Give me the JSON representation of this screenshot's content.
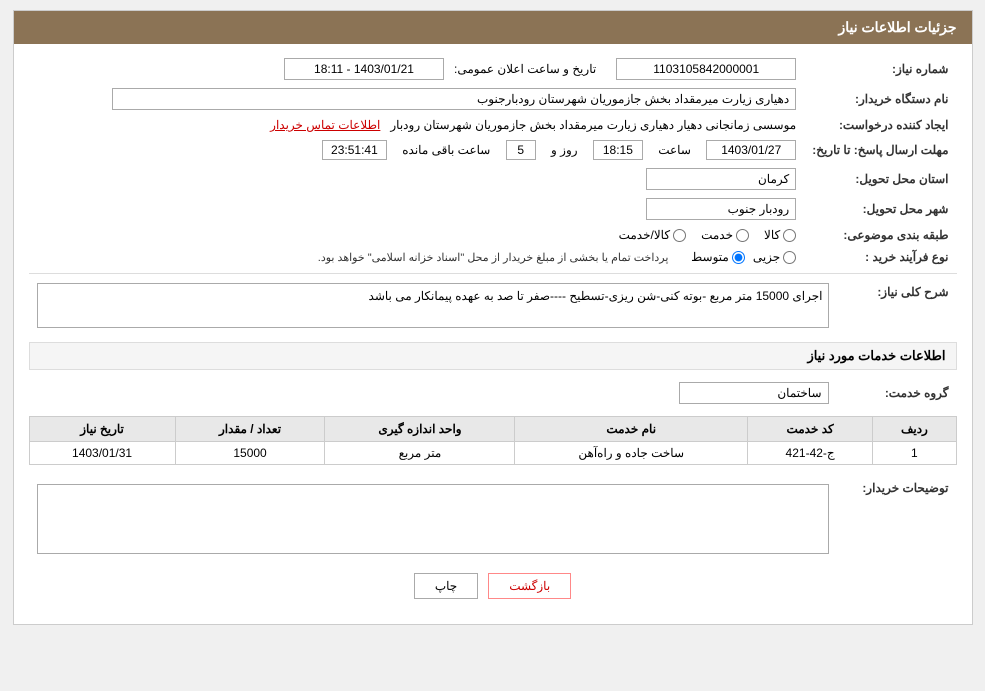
{
  "page": {
    "title": "جزئیات اطلاعات نیاز"
  },
  "header": {
    "title": "جزئیات اطلاعات نیاز"
  },
  "fields": {
    "need_number_label": "شماره نیاز:",
    "need_number_value": "1103105842000001",
    "announcement_date_label": "تاریخ و ساعت اعلان عمومی:",
    "announcement_date_value": "1403/01/21 - 18:11",
    "buyer_name_label": "نام دستگاه خریدار:",
    "buyer_name_value": "دهیاری زیارت میرمقداد بخش جازموریان شهرستان رودبارجنوب",
    "creator_label": "ایجاد کننده درخواست:",
    "creator_value": "موسسی زمانجانی دهیار دهیاری زیارت میرمقداد بخش جازموریان شهرستان رودبار",
    "contact_link": "اطلاعات تماس خریدار",
    "response_deadline_label": "مهلت ارسال پاسخ: تا تاریخ:",
    "response_date_value": "1403/01/27",
    "response_time_label": "ساعت",
    "response_time_value": "18:15",
    "response_days_label": "روز و",
    "response_days_value": "5",
    "response_countdown_label": "ساعت باقی مانده",
    "response_countdown_value": "23:51:41",
    "province_label": "استان محل تحویل:",
    "province_value": "کرمان",
    "city_label": "شهر محل تحویل:",
    "city_value": "رودبار جنوب",
    "category_label": "طبقه بندی موضوعی:",
    "category_kala": "کالا",
    "category_khedmat": "خدمت",
    "category_kala_khedmat": "کالا/خدمت",
    "purchase_type_label": "نوع فرآیند خرید :",
    "purchase_jozii": "جزیی",
    "purchase_motovaset": "متوسط",
    "purchase_note": "پرداخت تمام یا بخشی از مبلغ خریدار از محل \"اسناد خزانه اسلامی\" خواهد بود.",
    "need_description_label": "شرح کلی نیاز:",
    "need_description_value": "اجرای 15000 متر مربع -بوته کنی-شن ریزی-تسطیح ----صفر تا صد به عهده پیمانکار می باشد",
    "services_section_label": "اطلاعات خدمات مورد نیاز",
    "service_group_label": "گروه خدمت:",
    "service_group_value": "ساختمان",
    "table_headers": {
      "row_num": "ردیف",
      "service_code": "کد خدمت",
      "service_name": "نام خدمت",
      "unit": "واحد اندازه گیری",
      "quantity": "تعداد / مقدار",
      "need_date": "تاریخ نیاز"
    },
    "table_rows": [
      {
        "row_num": "1",
        "service_code": "ج-42-421",
        "service_name": "ساخت جاده و راه‌آهن",
        "unit": "متر مربع",
        "quantity": "15000",
        "need_date": "1403/01/31"
      }
    ],
    "buyer_notes_label": "توضیحات خریدار:",
    "buyer_notes_value": ""
  },
  "buttons": {
    "print": "چاپ",
    "back": "بازگشت"
  }
}
